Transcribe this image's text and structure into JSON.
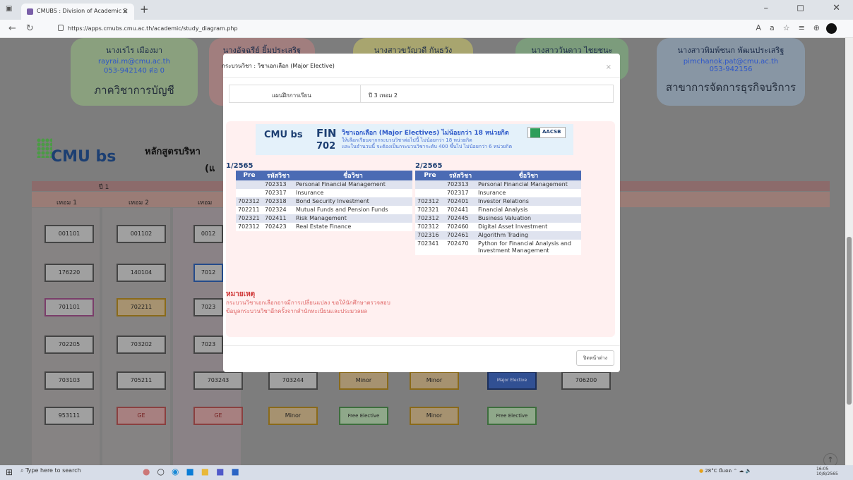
{
  "browser": {
    "tab_title": "CMUBS : Division of Academic S",
    "new_tab": "+",
    "url": "https://apps.cmubs.cmu.ac.th/academic/study_diagram.php",
    "window_controls": "– ◻ ✕"
  },
  "contacts": [
    {
      "name": "นางเรไร เมืองมา",
      "email": "rayrai.m@cmu.ac.th",
      "phone": "053-942140 ต่อ 0",
      "dept": "ภาควิชาการบัญชี"
    },
    {
      "name": "นางอัจฉรีย์ ยิ้มประเสริฐ",
      "email": "",
      "phone": "",
      "dept": ""
    },
    {
      "name": "นางสาวขวัญวดี กันธวัง",
      "email": "",
      "phone": "",
      "dept": ""
    },
    {
      "name": "นางสาววันดาว ไชยชนะ",
      "email": "",
      "phone": "",
      "dept": ""
    },
    {
      "name": "นางสาวพิมพ์ชนก พัฒนประเสริฐ",
      "email": "pimchanok.pat@cmu.ac.th",
      "phone": "053-942156",
      "dept": "สาขาการจัดการธุรกิจบริการ"
    }
  ],
  "background_page": {
    "logo": "CMU bs",
    "curriculum_title": "หลักสูตรบริหา",
    "curriculum_sub": "(แ",
    "year_label": "ปี 1",
    "semesters": [
      "เทอม 1",
      "เทอม 2",
      "เทอม"
    ],
    "courses_col1": [
      "001101",
      "176220",
      "701101",
      "702205",
      "703103",
      "953111"
    ],
    "courses_col2": [
      "001102",
      "140104",
      "702211",
      "703202",
      "705211",
      "GE"
    ],
    "courses_col3": [
      "0012",
      "7012",
      "7023",
      "7023",
      "703243",
      "GE"
    ],
    "courses_col4": [
      "703244",
      "Minor"
    ],
    "courses_col5": [
      "Minor",
      "Free Elective"
    ],
    "courses_col6": [
      "Minor",
      "Minor"
    ],
    "courses_col7": [
      "Major Elective",
      "Free Elective"
    ],
    "courses_col8": [
      "706200"
    ]
  },
  "modal": {
    "title": "กระบวนวิชา : วิชาเอกเลือก (Major Elective)",
    "close_icon": "×",
    "plan_label": "แผนฝึกการเรียน",
    "plan_value": "ปี 3 เทอม 2",
    "banner": {
      "code_prefix": "FIN",
      "code_num": "702",
      "title": "วิชาเอกเลือก (Major Electives) ไม่น้อยกว่า 18 หน่วยกิต",
      "line2": "ให้เลือกเรียนจากกระบวนวิชาต่อไปนี้ ไม่น้อยกว่า 18 หน่วยกิต",
      "line3": "และในจำนวนนี้ จะต้องเป็นกระบวนวิชาระดับ 400 ขึ้นไป ไม่น้อยกว่า 6 หน่วยกิต",
      "badge": "AACSB"
    },
    "columns": [
      "Pre",
      "รหัสวิชา",
      "ชื่อวิชา"
    ],
    "sem1": {
      "label": "1/2565",
      "rows": [
        {
          "pre": "",
          "code": "702313",
          "name": "Personal Financial Management"
        },
        {
          "pre": "",
          "code": "702317",
          "name": "Insurance"
        },
        {
          "pre": "702312",
          "code": "702318",
          "name": "Bond Security Investment"
        },
        {
          "pre": "702211",
          "code": "702324",
          "name": "Mutual Funds and Pension Funds"
        },
        {
          "pre": "702321",
          "code": "702411",
          "name": "Risk Management"
        },
        {
          "pre": "702312",
          "code": "702423",
          "name": "Real Estate Finance"
        }
      ]
    },
    "sem2": {
      "label": "2/2565",
      "rows": [
        {
          "pre": "",
          "code": "702313",
          "name": "Personal Financial Management"
        },
        {
          "pre": "",
          "code": "702317",
          "name": "Insurance"
        },
        {
          "pre": "702312",
          "code": "702401",
          "name": "Investor Relations"
        },
        {
          "pre": "702321",
          "code": "702441",
          "name": "Financial Analysis"
        },
        {
          "pre": "702312",
          "code": "702445",
          "name": "Business Valuation"
        },
        {
          "pre": "702312",
          "code": "702460",
          "name": "Digital Asset Investment"
        },
        {
          "pre": "702316",
          "code": "702461",
          "name": "Algorithm Trading"
        },
        {
          "pre": "702341",
          "code": "702470",
          "name": "Python for Financial Analysis and Investment Management"
        }
      ]
    },
    "note_heading": "หมายเหตุ",
    "note_body": "กระบวนวิชาเอกเลือกอาจมีการเปลี่ยนแปลง ขอให้นักศึกษาตรวจสอบข้อมูลกระบวนวิชาอีกครั้งจากสำนักทะเบียนและประมวลผล",
    "close_button": "ปิดหน้าต่าง"
  },
  "taskbar": {
    "search_placeholder": "Type here to search",
    "weather": "28°C มีแดด",
    "time": "16:05",
    "date": "10/8/2565"
  }
}
